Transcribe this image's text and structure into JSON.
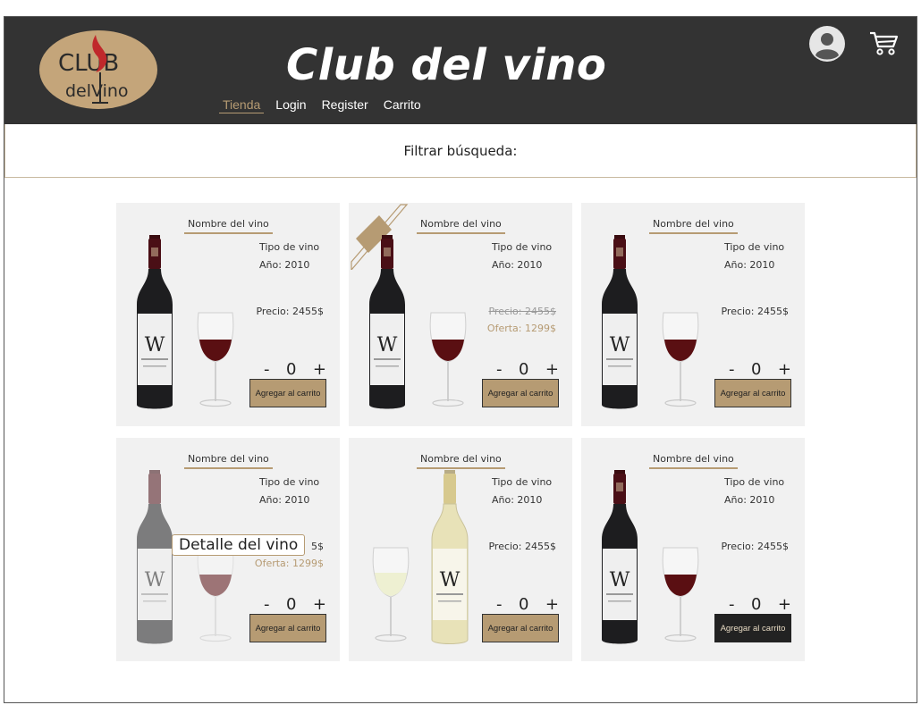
{
  "header": {
    "title": "Club del vino",
    "logo": {
      "line1": "CLUB",
      "line2": "delVino"
    },
    "nav": [
      {
        "label": "Tienda",
        "active": true
      },
      {
        "label": "Login",
        "active": false
      },
      {
        "label": "Register",
        "active": false
      },
      {
        "label": "Carrito",
        "active": false
      }
    ],
    "icons": {
      "user": "user-avatar-icon",
      "cart": "shopping-cart-icon"
    }
  },
  "filter": {
    "label": "Filtrar búsqueda:"
  },
  "products": [
    {
      "name": "Nombre del vino",
      "type": "Tipo de vino",
      "year": "Año: 2010",
      "price": "Precio: 2455$",
      "offer": null,
      "qty": "0",
      "minus": "-",
      "plus": "+",
      "button": "Agregar al carrito",
      "wine": "red",
      "on_sale": false
    },
    {
      "name": "Nombre del vino",
      "type": "Tipo de vino",
      "year": "Año: 2010",
      "price": "Precio: 2455$",
      "offer": "Oferta: 1299$",
      "qty": "0",
      "minus": "-",
      "plus": "+",
      "button": "Agregar al carrito",
      "wine": "red",
      "on_sale": true
    },
    {
      "name": "Nombre del vino",
      "type": "Tipo de vino",
      "year": "Año: 2010",
      "price": "Precio: 2455$",
      "offer": null,
      "qty": "0",
      "minus": "-",
      "plus": "+",
      "button": "Agregar al carrito",
      "wine": "red",
      "on_sale": false
    },
    {
      "name": "Nombre del vino",
      "type": "Tipo de vino",
      "year": "Año: 2010",
      "price": "5$",
      "offer": "Oferta: 1299$",
      "qty": "0",
      "minus": "-",
      "plus": "+",
      "button": "Agregar al carrito",
      "wine": "red",
      "on_sale": true,
      "hovered": true,
      "tooltip": "Detalle del vino"
    },
    {
      "name": "Nombre del vino",
      "type": "Tipo de vino",
      "year": "Año: 2010",
      "price": "Precio: 2455$",
      "offer": null,
      "qty": "0",
      "minus": "-",
      "plus": "+",
      "button": "Agregar al carrito",
      "wine": "white",
      "on_sale": false
    },
    {
      "name": "Nombre del vino",
      "type": "Tipo de vino",
      "year": "Año: 2010",
      "price": "Precio: 2455$",
      "offer": null,
      "qty": "0",
      "minus": "-",
      "plus": "+",
      "button": "Agregar al carrito",
      "wine": "red",
      "on_sale": false,
      "button_active": true
    }
  ],
  "bottle_label": {
    "letter": "W",
    "brand": "VILARDEIR"
  },
  "colors": {
    "header_bg": "#333333",
    "accent": "#b69b73",
    "card_bg": "#f1f1f1",
    "red_wine": "#5a0f12",
    "white_wine": "#e8e2b8"
  }
}
